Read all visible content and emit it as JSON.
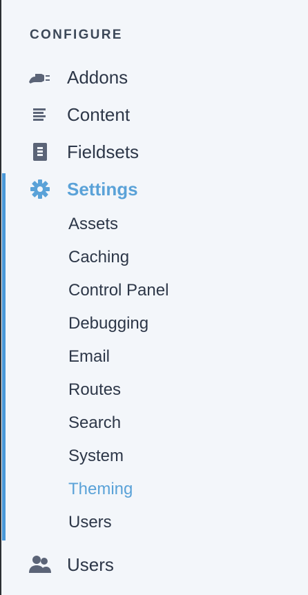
{
  "nav": {
    "section_title": "CONFIGURE",
    "items": [
      {
        "label": "Addons",
        "icon": "plug-icon"
      },
      {
        "label": "Content",
        "icon": "content-lines-icon"
      },
      {
        "label": "Fieldsets",
        "icon": "document-icon"
      },
      {
        "label": "Settings",
        "icon": "gear-icon",
        "active": true
      },
      {
        "label": "Users",
        "icon": "users-icon"
      }
    ],
    "settings_subitems": [
      {
        "label": "Assets"
      },
      {
        "label": "Caching"
      },
      {
        "label": "Control Panel"
      },
      {
        "label": "Debugging"
      },
      {
        "label": "Email"
      },
      {
        "label": "Routes"
      },
      {
        "label": "Search"
      },
      {
        "label": "System"
      },
      {
        "label": "Theming",
        "current": true
      },
      {
        "label": "Users"
      }
    ]
  },
  "colors": {
    "background": "#f3f6fa",
    "text": "#2d3748",
    "heading": "#3c4858",
    "accent": "#5aa2d8",
    "active_bar": "#4a98d7",
    "icon": "#5b6477"
  }
}
